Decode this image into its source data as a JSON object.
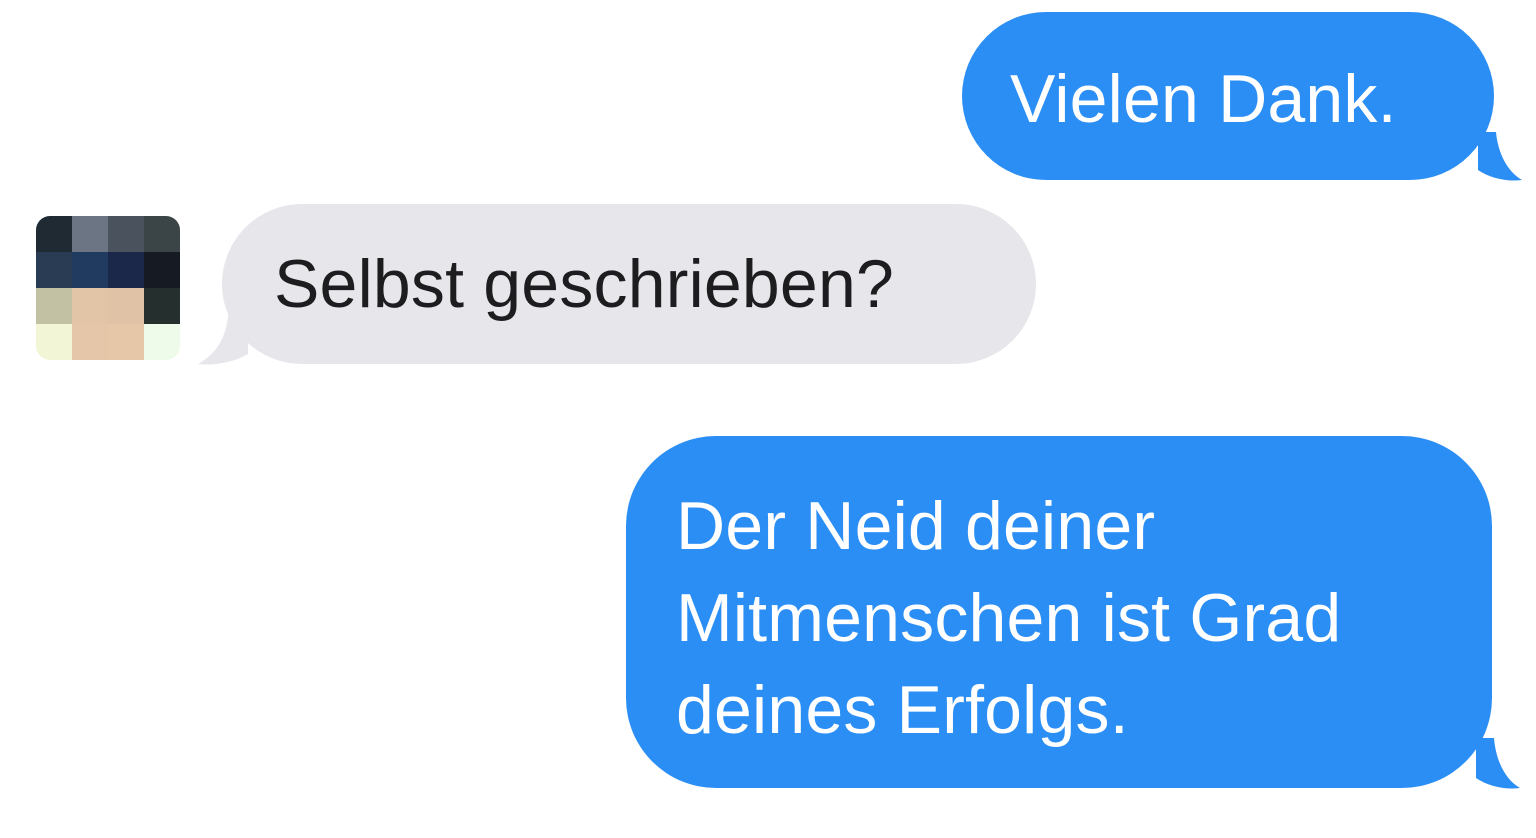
{
  "conversation": {
    "messages": [
      {
        "sender": "me",
        "text": "Vielen Dank."
      },
      {
        "sender": "contact",
        "text": "Selbst geschrieben?"
      },
      {
        "sender": "me",
        "text": "Der Neid deiner\nMitmenschen ist Grad\ndeines Erfolgs."
      }
    ]
  },
  "colors": {
    "outgoing_bubble": "#2b8ef5",
    "incoming_bubble": "#e6e6eb",
    "background": "#ffffff"
  },
  "contact": {
    "avatar": "pixelated-avatar-icon"
  }
}
